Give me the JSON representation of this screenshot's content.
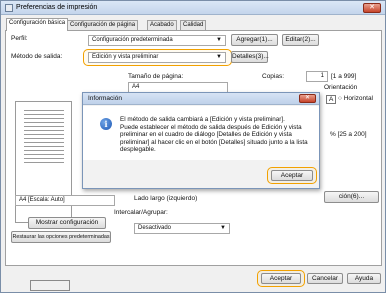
{
  "window": {
    "title": "Preferencias de impresión",
    "close_label": "✕"
  },
  "tabs": [
    "Configuración básica",
    "Configuración de página",
    "Acabado",
    "Calidad"
  ],
  "profile": {
    "label": "Perfil:",
    "value": "Configuración predeterminada",
    "add_label": "Agregar(1)...",
    "edit_label": "Editar(2)..."
  },
  "output": {
    "label": "Método de salida:",
    "value": "Edición y vista preliminar",
    "details_label": "Detalles(3)..."
  },
  "page_size": {
    "label": "Tamaño de página:",
    "value": "A4"
  },
  "copies": {
    "label": "Copias:",
    "value": "1",
    "range": "[1 a 999]"
  },
  "orientation": {
    "label": "Orientación",
    "option_a": "A",
    "option_horizontal": "Horizontal"
  },
  "scale_fragment": "% [25 a 200]",
  "preview": {
    "caption": "A4 [Escala: Auto]"
  },
  "binding": {
    "value": "Lado largo (izquierdo)",
    "button_fragment": "ción(6)..."
  },
  "collate": {
    "label": "Intercalar/Agrupar:",
    "value": "Desactivado"
  },
  "left_buttons": {
    "show": "Mostrar configuración",
    "restore": "Restaurar las opciones predeterminadas"
  },
  "dialog": {
    "title": "Información",
    "close_label": "✕",
    "message_lines": [
      "El método de salida cambiará a [Edición y vista preliminar].",
      "Puede establecer el método de salida después de Edición y vista",
      "preliminar en el cuadro de diálogo [Detalles de Edición y vista",
      "preliminar] al hacer clic en el botón [Detalles] situado junto a la lista",
      "desplegable."
    ],
    "accept_label": "Aceptar"
  },
  "footer": {
    "accept": "Aceptar",
    "cancel": "Cancelar",
    "help": "Ayuda"
  }
}
